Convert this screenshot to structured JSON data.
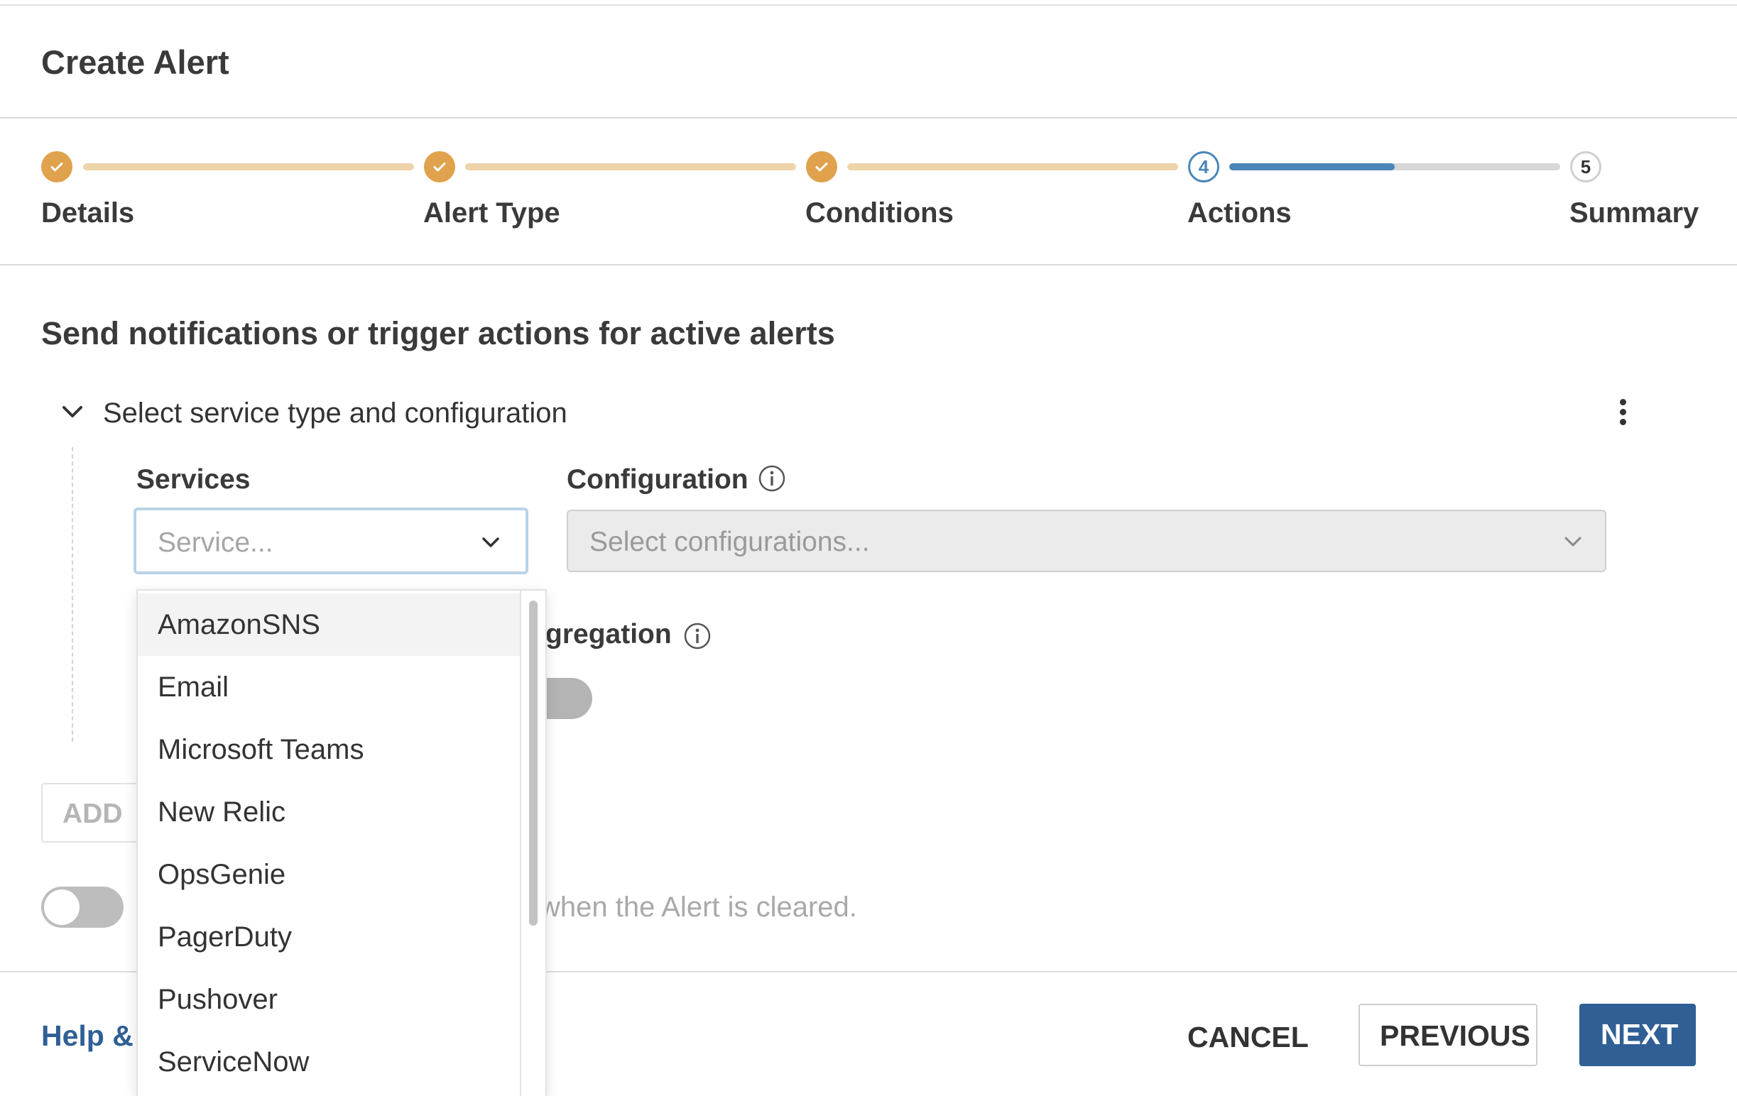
{
  "dialog": {
    "title": "Create Alert"
  },
  "stepper": {
    "steps": [
      {
        "label": "Details",
        "state": "done"
      },
      {
        "label": "Alert Type",
        "state": "done"
      },
      {
        "label": "Conditions",
        "state": "done"
      },
      {
        "label": "Actions",
        "state": "current",
        "number": "4"
      },
      {
        "label": "Summary",
        "state": "future",
        "number": "5"
      }
    ],
    "current_progress": 0.5,
    "colors": {
      "done": "#e0a24d",
      "current": "#4a86b8"
    }
  },
  "section": {
    "title": "Send notifications or trigger actions for active alerts",
    "group_label": "Select service type and configuration"
  },
  "services": {
    "label": "Services",
    "placeholder": "Service...",
    "options": [
      "AmazonSNS",
      "Email",
      "Microsoft Teams",
      "New Relic",
      "OpsGenie",
      "PagerDuty",
      "Pushover",
      "ServiceNow"
    ],
    "highlighted": "AmazonSNS"
  },
  "configuration": {
    "label": "Configuration",
    "placeholder": "Select configurations..."
  },
  "aggregation": {
    "label_visible": "gregation"
  },
  "add_button": {
    "label": "ADD"
  },
  "cleared_toggle": {
    "text_visible": "when the Alert is cleared.",
    "on": false
  },
  "footer": {
    "help_visible": "Help &",
    "cancel": "CANCEL",
    "previous": "PREVIOUS",
    "next": "NEXT"
  }
}
